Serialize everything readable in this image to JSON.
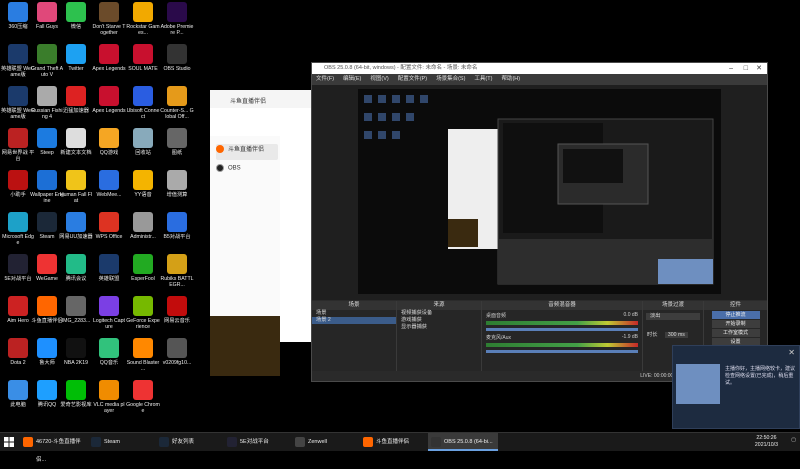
{
  "desktop": {
    "icons": [
      {
        "label": "360压缩",
        "color": "#2a7de1"
      },
      {
        "label": "Fall Guys",
        "color": "#e0487a"
      },
      {
        "label": "微信",
        "color": "#2dc14e"
      },
      {
        "label": "Don't Starve Together",
        "color": "#6b4b2a"
      },
      {
        "label": "Rockstar Games...",
        "color": "#f2a900"
      },
      {
        "label": "Adobe Premiere P...",
        "color": "#2a0a4a"
      },
      {
        "label": "英雄联盟 WeGame版",
        "color": "#1b3a6b"
      },
      {
        "label": "Grand Theft Auto V",
        "color": "#3a7d2b"
      },
      {
        "label": "Twitter",
        "color": "#1da1f2"
      },
      {
        "label": "Apex Legends",
        "color": "#c8102e"
      },
      {
        "label": "SOUL MATE",
        "color": "#c8102e"
      },
      {
        "label": "OBS Studio",
        "color": "#333"
      },
      {
        "label": "英雄联盟 WeGame版",
        "color": "#1b3a6b"
      },
      {
        "label": "Russian Fishing 4",
        "color": "#aaa"
      },
      {
        "label": "迅猛加速器",
        "color": "#d22"
      },
      {
        "label": "Apex Legends",
        "color": "#c8102e"
      },
      {
        "label": "Ubisoft Connect",
        "color": "#2a5de1"
      },
      {
        "label": "Counter-S... Global Off...",
        "color": "#e59a1a"
      },
      {
        "label": "网易世界战 平台",
        "color": "#b22"
      },
      {
        "label": "Steep",
        "color": "#1c7be0"
      },
      {
        "label": "新建文本文档",
        "color": "#ddd"
      },
      {
        "label": "QQ游戏",
        "color": "#f5a623"
      },
      {
        "label": "回收站",
        "color": "#8ab"
      },
      {
        "label": "图纸",
        "color": "#666"
      },
      {
        "label": "小助手",
        "color": "#b11"
      },
      {
        "label": "Wallpaper Engine",
        "color": "#1c6fd6"
      },
      {
        "label": "Human Fall Flat",
        "color": "#f0c419"
      },
      {
        "label": "WebMee...",
        "color": "#2a6de0"
      },
      {
        "label": "YY语音",
        "color": "#f4b400"
      },
      {
        "label": "增值测算",
        "color": "#aaa"
      },
      {
        "label": "Microsoft Edge",
        "color": "#1da1c8"
      },
      {
        "label": "Steam",
        "color": "#1b2838"
      },
      {
        "label": "网易UU加速器",
        "color": "#2a7de1"
      },
      {
        "label": "WPS Office",
        "color": "#d32"
      },
      {
        "label": "Administr...",
        "color": "#999"
      },
      {
        "label": "B5对战平台",
        "color": "#2a6de0"
      },
      {
        "label": "5E对战平台",
        "color": "#223"
      },
      {
        "label": "WeGame",
        "color": "#e33"
      },
      {
        "label": "腾讯会议",
        "color": "#2b8"
      },
      {
        "label": "英雄联盟",
        "color": "#1b3a6b"
      },
      {
        "label": "EsperFool",
        "color": "#2a2"
      },
      {
        "label": "Rubiks BATTLEGR...",
        "color": "#d4a017"
      },
      {
        "label": "Aim Hero",
        "color": "#c22"
      },
      {
        "label": "斗鱼直播伴侣",
        "color": "#f60"
      },
      {
        "label": "IMG_2283...",
        "color": "#666"
      },
      {
        "label": "Logitech Capture",
        "color": "#7b3fe4"
      },
      {
        "label": "GeForce Experience",
        "color": "#76b900"
      },
      {
        "label": "网易云音乐",
        "color": "#c20c0c"
      },
      {
        "label": "Dota 2",
        "color": "#b22"
      },
      {
        "label": "鲁大师",
        "color": "#1e90ff"
      },
      {
        "label": "NBA 2K19",
        "color": "#111"
      },
      {
        "label": "QQ音乐",
        "color": "#31c27c"
      },
      {
        "label": "Sound Blaster ...",
        "color": "#f80"
      },
      {
        "label": "v0209fg10...",
        "color": "#555"
      },
      {
        "label": "此电脑",
        "color": "#3a8ee6"
      },
      {
        "label": "腾讯QQ",
        "color": "#1e9fff"
      },
      {
        "label": "爱奇艺影视库",
        "color": "#00be06"
      },
      {
        "label": "VLC media player",
        "color": "#f08c00"
      },
      {
        "label": "Google Chrome",
        "color": "#e33"
      }
    ]
  },
  "douyu": {
    "title": "斗鱼直播伴侣",
    "tabs": [
      {
        "label": "斗鱼直播伴侣"
      },
      {
        "label": "OBS"
      }
    ]
  },
  "obs": {
    "title": "OBS 25.0.8 (64-bit, windows) - 配置文件: 未命名 - 场景: 未命名",
    "menu": [
      "文件(F)",
      "编辑(E)",
      "视图(V)",
      "配置文件(P)",
      "场景集合(S)",
      "工具(T)",
      "帮助(H)"
    ],
    "scenes_header": "场景",
    "scenes": [
      "场景",
      "场景 2"
    ],
    "sources_header": "来源",
    "sources": [
      "视频捕获设备",
      "游戏捕获",
      "显示器捕获"
    ],
    "mixer_header": "音频混音器",
    "mixer": [
      {
        "name": "桌面音频",
        "value": "0.0 dB"
      },
      {
        "name": "麦克风/Aux",
        "value": "-1.9 dB"
      }
    ],
    "transition_header": "场景过渡",
    "transition_value": "淡出",
    "duration_label": "时长",
    "duration_value": "300 ms",
    "controls_header": "控件",
    "controls": [
      {
        "label": "停止推流",
        "active": true
      },
      {
        "label": "开始录制",
        "active": false
      },
      {
        "label": "工作室模式",
        "active": false
      },
      {
        "label": "设置",
        "active": false
      },
      {
        "label": "退出",
        "active": false
      }
    ],
    "status": "LIVE: 00:00:00   REC: 00:00:00   CPU: 2.4%, 60.00 fps"
  },
  "notification": {
    "text": "主播你好，主播网络较卡，建议检查网络设置(已完成)，稍后重试。"
  },
  "taskbar": {
    "items": [
      {
        "label": "46720-斗鱼直播伴侣...",
        "color": "#f60",
        "active": false
      },
      {
        "label": "Steam",
        "color": "#1b2838",
        "active": false
      },
      {
        "label": "好友列表",
        "color": "#1b2838",
        "active": false
      },
      {
        "label": "5E对战平台",
        "color": "#223",
        "active": false
      },
      {
        "label": "Zenwell",
        "color": "#444",
        "active": false
      },
      {
        "label": "斗鱼直播伴侣",
        "color": "#f60",
        "active": false
      },
      {
        "label": "OBS 25.0.8 (64-bi...",
        "color": "#333",
        "active": true
      }
    ],
    "clock_time": "22:50:26",
    "clock_date": "2021/10/3"
  }
}
